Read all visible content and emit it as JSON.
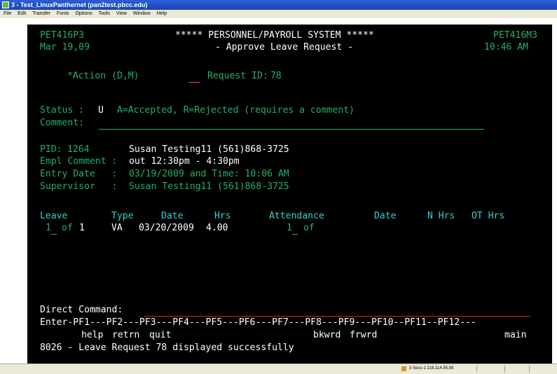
{
  "window": {
    "title": "3 - Test_LinuxPanthernet (pan2test.pbcc.edu)"
  },
  "menu": [
    "File",
    "Edit",
    "Transfer",
    "Fonts",
    "Options",
    "Tools",
    "View",
    "Window",
    "Help"
  ],
  "header": {
    "screen_id": "PET416P3",
    "system_title": "***** PERSONNEL/PAYROLL SYSTEM *****",
    "map_id": "PET416M3",
    "date": "Mar 19,09",
    "screen_title": "- Approve Leave Request -",
    "time": "10:46 AM"
  },
  "action": {
    "label": "*Action (D,M)",
    "value": "",
    "request_label": "Request ID:",
    "request_id": "78"
  },
  "status": {
    "label": "Status :",
    "value": "U",
    "legend": "A=Accepted, R=Rejected (requires a comment)",
    "comment_label": "Comment:",
    "comment_value": ""
  },
  "employee": {
    "pid_label": "PID:",
    "pid": "1264",
    "name": "Susan Testing11 (561)868-3725",
    "comment_label": "Empl Comment :",
    "comment": "out 12:30pm - 4:30pm",
    "entry_label": "Entry Date   :",
    "entry": "03/19/2009 and Time: 10:06 AM",
    "supervisor_label": "Supervisor   :",
    "supervisor": "Susan Testing11 (561)868-3725"
  },
  "leave_table": {
    "headers": [
      "Leave",
      "Type",
      "Date",
      "Hrs",
      "Attendance",
      "Date",
      "N Hrs",
      "OT Hrs"
    ],
    "row": {
      "leave_no": "1",
      "of_label": "of",
      "leave_total": "1",
      "type": "VA",
      "date": "03/20/2009",
      "hrs": "4.00",
      "attendance_no": "1",
      "attendance_of": "of"
    }
  },
  "command": {
    "label": "Direct Command:",
    "value": ""
  },
  "pf_keys": {
    "line": "Enter-PF1---PF2---PF3---PF4---PF5---PF6---PF7---PF8---PF9---PF10--PF11--PF12---",
    "help": "help",
    "retrn": "retrn",
    "quit": "quit",
    "bkwrd": "bkwrd",
    "frwrd": "frwrd",
    "main": "main"
  },
  "message": "8026 - Leave Request 78 displayed successfully",
  "statusbar": {
    "session": "3  Sess-1  216.114.95.89"
  },
  "colors": {
    "green": "#21b06a",
    "cyan": "#35d0cf",
    "magenta": "#d040d0",
    "red": "#e02020",
    "background": "#000000"
  }
}
